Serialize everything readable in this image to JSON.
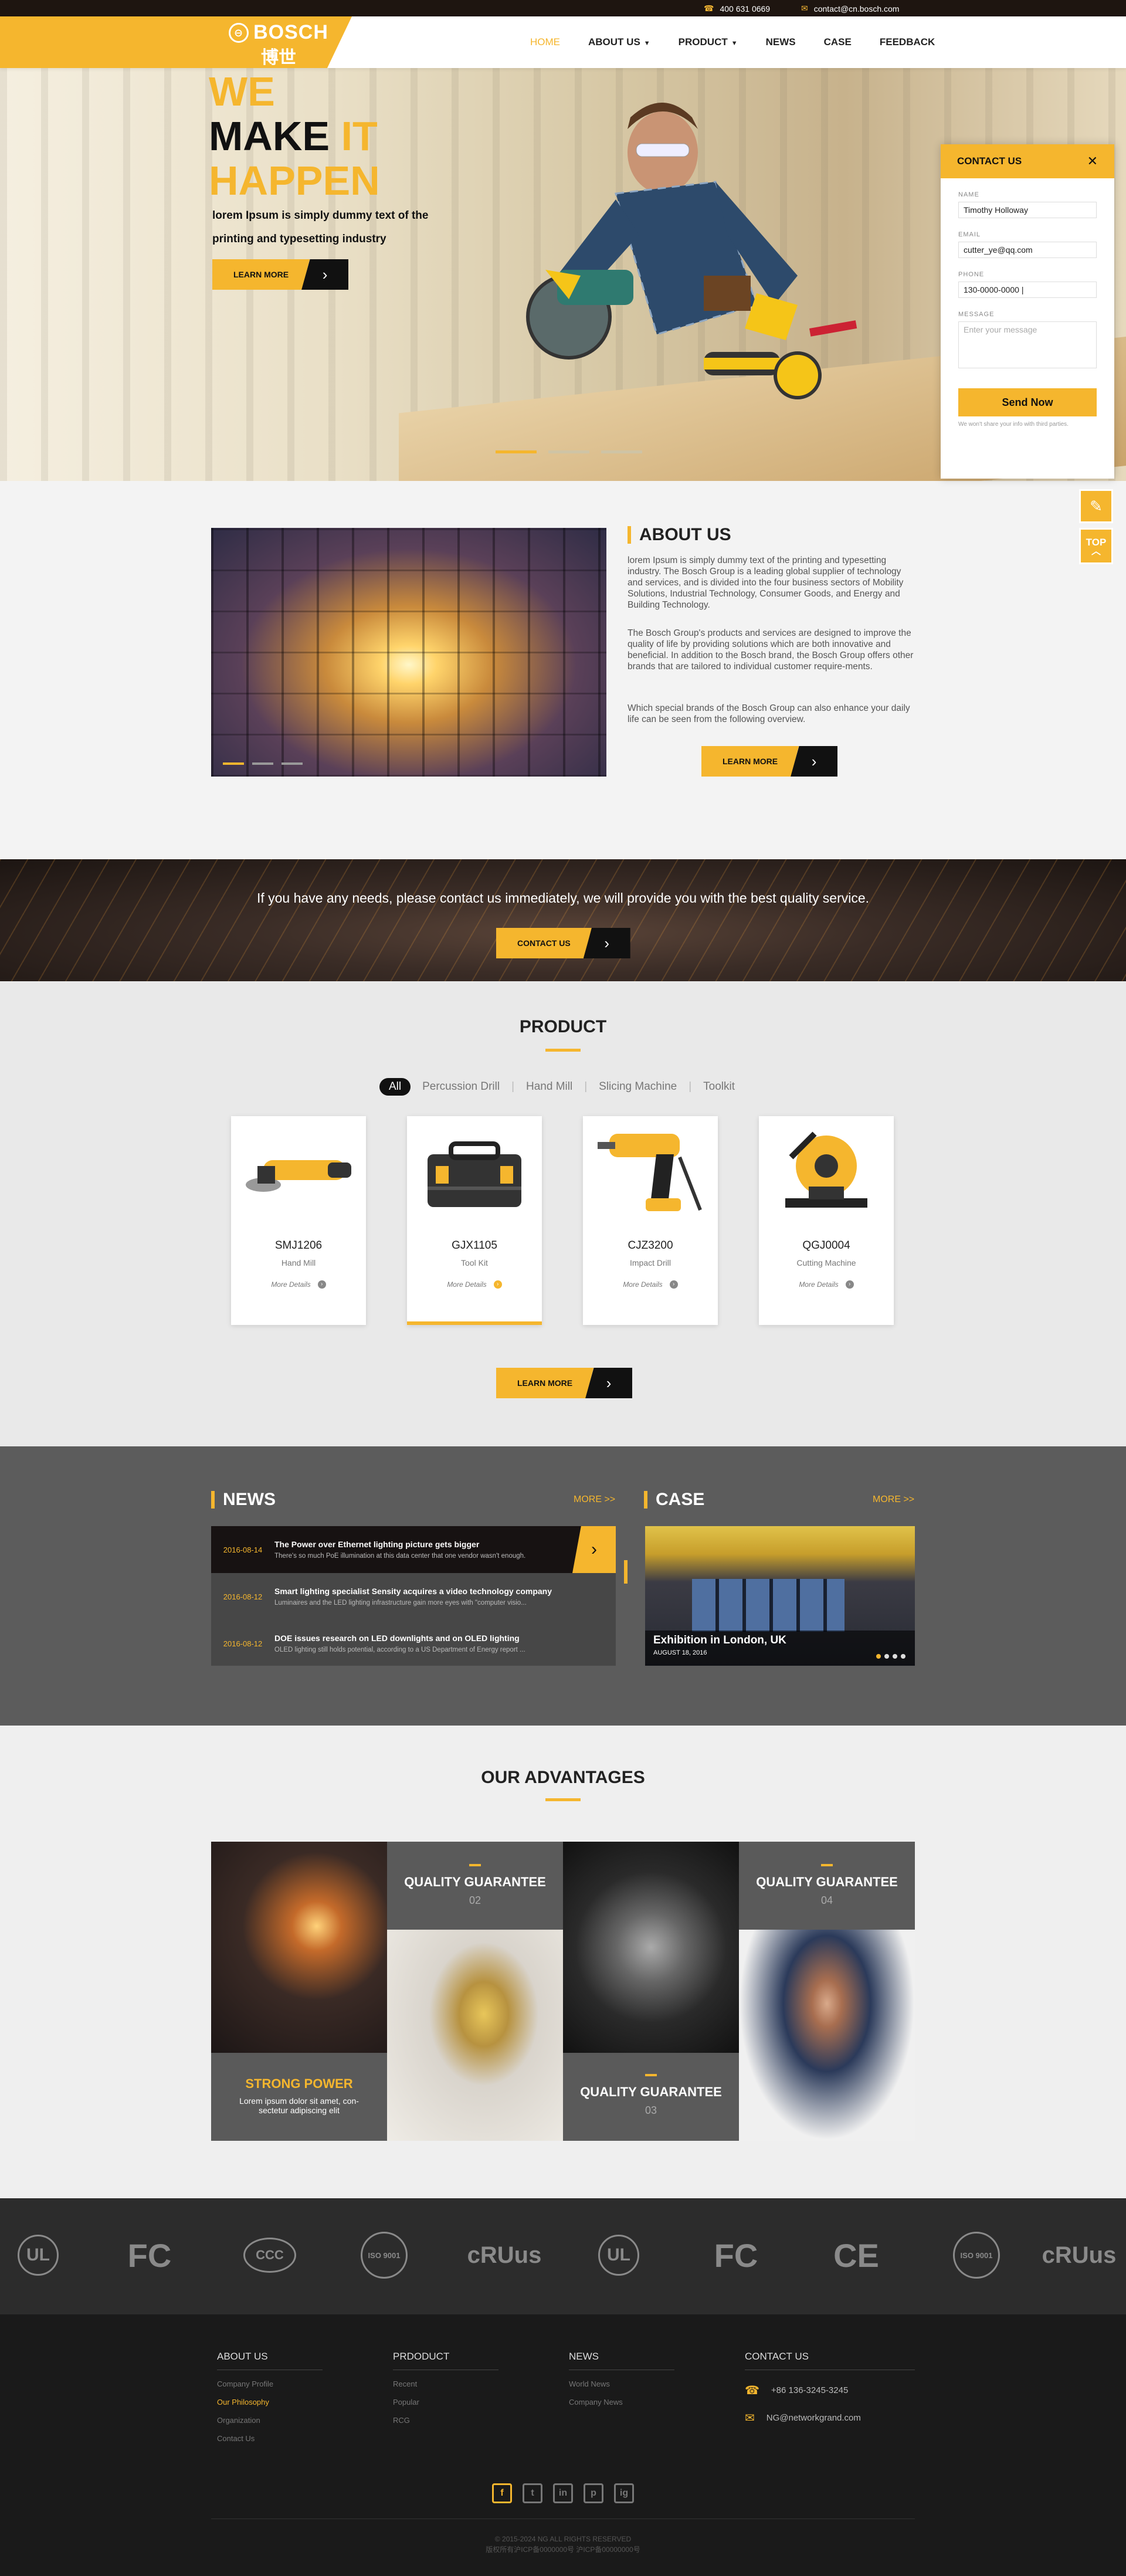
{
  "topbar": {
    "phone": "400 631 0669",
    "email": "contact@cn.bosch.com"
  },
  "brand": {
    "name": "BOSCH",
    "name_zh": "博世"
  },
  "nav": [
    "HOME",
    "ABOUT US",
    "PRODUCT",
    "NEWS",
    "CASE",
    "FEEDBACK"
  ],
  "hero": {
    "line1": "WE",
    "line2a": "MAKE",
    "line2b": "IT",
    "line3": "HAPPEN",
    "subtitle": "lorem Ipsum is simply dummy text of the printing and typesetting industry",
    "button": "LEARN MORE"
  },
  "contact": {
    "title": "CONTACT US",
    "name_label": "NAME",
    "name_value": "Timothy Holloway",
    "email_label": "EMAIL",
    "email_value": "cutter_ye@qq.com",
    "phone_label": "PHONE",
    "phone_value": "130-0000-0000 |",
    "message_label": "MESSAGE",
    "message_placeholder": "Enter your message",
    "send": "Send Now",
    "note": "We won't share your info with third parties."
  },
  "side": {
    "top": "TOP"
  },
  "about": {
    "title": "ABOUT US",
    "p1": "lorem Ipsum is simply dummy text of the printing and typesetting industry. The Bosch Group is a leading global supplier of technology and services, and is divided into the four business sectors of Mobility Solutions, Industrial Technology, Consumer Goods, and Energy and Building Technology.",
    "p2": "The Bosch Group's products and services are designed to improve the quality of life by providing solutions which are both innovative and beneficial. In addition to the Bosch brand, the Bosch Group offers other brands that are tailored to individual customer require-ments.",
    "p3": "Which special brands of the Bosch Group can also enhance your daily life can be seen from the following overview.",
    "button": "LEARN MORE"
  },
  "banner": {
    "text": "If you have any needs, please contact us immediately, we will provide you with the best quality service.",
    "button": "CONTACT US"
  },
  "product": {
    "title": "PRODUCT",
    "filters": [
      "All",
      "Percussion Drill",
      "Hand Mill",
      "Slicing Machine",
      "Toolkit"
    ],
    "items": [
      {
        "code": "SMJ1206",
        "cat": "Hand Mill",
        "more": "More Details"
      },
      {
        "code": "GJX1105",
        "cat": "Tool Kit",
        "more": "More Details"
      },
      {
        "code": "CJZ3200",
        "cat": "Impact Drill",
        "more": "More Details"
      },
      {
        "code": "QGJ0004",
        "cat": "Cutting Machine",
        "more": "More Details"
      }
    ],
    "button": "LEARN MORE"
  },
  "news": {
    "title": "NEWS",
    "more": "MORE >>",
    "items": [
      {
        "date": "2016-08-14",
        "title": "The Power over Ethernet lighting picture gets bigger",
        "summary": "There's so much PoE illumination at this data center that one vendor wasn't enough."
      },
      {
        "date": "2016-08-12",
        "title": "Smart lighting specialist Sensity acquires a video technology company",
        "summary": "Luminaires and the LED lighting infrastructure gain more eyes with \"computer visio..."
      },
      {
        "date": "2016-08-12",
        "title": "DOE issues research on LED downlights and on OLED lighting",
        "summary": "OLED lighting still holds potential, according to a US Department of Energy report ..."
      }
    ]
  },
  "case": {
    "title": "CASE",
    "more": "MORE >>",
    "caption": "Exhibition in London, UK",
    "date": "AUGUST 18, 2016"
  },
  "advantages": {
    "title": "OUR ADVANTAGES",
    "t1": "STRONG POWER",
    "t1_desc": "Lorem ipsum dolor sit amet, con-sectetur adipiscing elit",
    "t2": "QUALITY GUARANTEE",
    "n2": "02",
    "t3": "QUALITY GUARANTEE",
    "n3": "03",
    "t4": "QUALITY GUARANTEE",
    "n4": "04"
  },
  "certs": [
    "UL",
    "FC",
    "CCC",
    "ISO 9001",
    "cRUus",
    "UL",
    "FC",
    "CE",
    "ISO 9001",
    "cRUus"
  ],
  "footer": {
    "about": {
      "title": "ABOUT US",
      "links": [
        "Company Profile",
        "Our Philosophy",
        "Organization",
        "Contact Us"
      ]
    },
    "product": {
      "title": "PRDODUCT",
      "links": [
        "Recent",
        "Popular",
        "RCG"
      ]
    },
    "news": {
      "title": "NEWS",
      "links": [
        "World News",
        "Company News"
      ]
    },
    "contact": {
      "title": "CONTACT US",
      "phone": "+86 136-3245-3245",
      "email": "NG@networkgrand.com"
    },
    "social": [
      "f",
      "t",
      "in",
      "p",
      "ig"
    ],
    "copyright": "© 2015-2024  NG ALL RIGHTS RESERVED",
    "icp": "版权所有沪ICP备0000000号  沪ICP备00000000号"
  },
  "colors": {
    "accent": "#f5b62e",
    "dark": "#1a1a1a",
    "gray": "#5c5c5c"
  }
}
